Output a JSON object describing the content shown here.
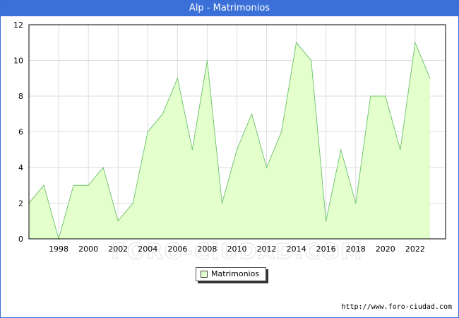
{
  "title": "Alp - Matrimonios",
  "colors": {
    "fill": "#e3ffcc",
    "line": "#77c577",
    "title_bg": "#3a70d8",
    "grid": "#dddddd"
  },
  "chart_data": {
    "type": "area",
    "title": "Alp - Matrimonios",
    "x": [
      1996,
      1997,
      1998,
      1999,
      2000,
      2001,
      2002,
      2003,
      2004,
      2005,
      2006,
      2007,
      2008,
      2009,
      2010,
      2011,
      2012,
      2013,
      2014,
      2015,
      2016,
      2017,
      2018,
      2019,
      2020,
      2021,
      2022,
      2023
    ],
    "series": [
      {
        "name": "Matrimonios",
        "values": [
          2,
          3,
          0,
          3,
          3,
          4,
          1,
          2,
          6,
          7,
          9,
          5,
          10,
          2,
          5,
          7,
          4,
          6,
          11,
          10,
          1,
          5,
          2,
          8,
          8,
          5,
          11,
          9
        ]
      }
    ],
    "xticks": [
      "1998",
      "2000",
      "2002",
      "2004",
      "2006",
      "2008",
      "2010",
      "2012",
      "2014",
      "2016",
      "2018",
      "2020",
      "2022"
    ],
    "yticks": [
      "0",
      "2",
      "4",
      "6",
      "8",
      "10",
      "12"
    ],
    "ylim": [
      0,
      12
    ],
    "xlim": [
      1996,
      2024.05
    ],
    "grid": true,
    "legend": "bottom-center"
  },
  "legend": {
    "label": "Matrimonios"
  },
  "watermark": "FORO-CIUDAD.COM",
  "footer": "http://www.foro-ciudad.com"
}
